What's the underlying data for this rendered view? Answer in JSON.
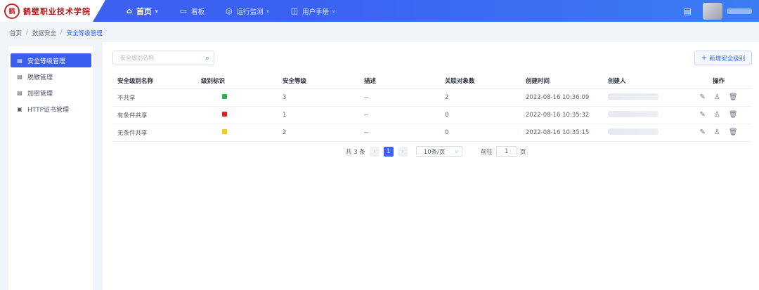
{
  "app": {
    "logo_text": "鹤壁职业技术学院",
    "logo_seal": "鹤"
  },
  "nav": {
    "items": [
      {
        "label": "首页",
        "icon": "home-icon",
        "active": true
      },
      {
        "label": "看板",
        "icon": "monitor-icon",
        "active": false
      },
      {
        "label": "运行监测",
        "icon": "radar-icon",
        "active": false
      },
      {
        "label": "用户手册",
        "icon": "book-icon",
        "active": false
      }
    ]
  },
  "breadcrumb": [
    "首页",
    "数据安全",
    "安全等级管理"
  ],
  "sidebar": {
    "items": [
      {
        "label": "安全等级管理",
        "icon": "list-icon",
        "active": true
      },
      {
        "label": "脱敏管理",
        "icon": "list-icon",
        "active": false
      },
      {
        "label": "加密管理",
        "icon": "list-icon",
        "active": false
      },
      {
        "label": "HTTP证书管理",
        "icon": "certificate-icon",
        "active": false
      }
    ]
  },
  "toolbar": {
    "search_placeholder": "安全级别名称",
    "add_label": "新增安全级别"
  },
  "table": {
    "headers": [
      "安全级别名称",
      "级别标识",
      "安全等级",
      "描述",
      "关联对象数",
      "创建时间",
      "创建人",
      "操作"
    ],
    "rows": [
      {
        "name": "不共享",
        "color": "#2bb24c",
        "level": "3",
        "desc": "--",
        "count": "2",
        "created": "2022-08-16 10:36:09"
      },
      {
        "name": "有条件共享",
        "color": "#e02020",
        "level": "1",
        "desc": "--",
        "count": "0",
        "created": "2022-08-16 10:35:32"
      },
      {
        "name": "无条件共享",
        "color": "#f2cc1b",
        "level": "2",
        "desc": "--",
        "count": "0",
        "created": "2022-08-16 10:35:15"
      }
    ]
  },
  "pagination": {
    "total": "共 3 条",
    "current_page": "1",
    "page_size": "10条/页",
    "goto_label": "前往",
    "goto_value": "1",
    "goto_unit": "页"
  }
}
